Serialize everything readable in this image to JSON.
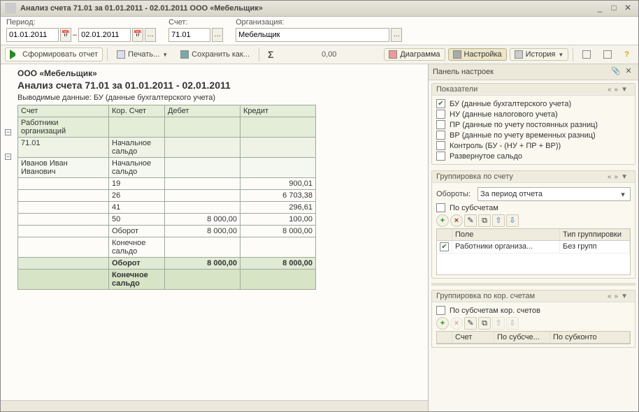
{
  "window": {
    "title": "Анализ счета 71.01 за 01.01.2011 - 02.01.2011 ООО «Мебельщик»"
  },
  "params": {
    "period_label": "Период:",
    "date_from": "01.01.2011",
    "date_to": "02.01.2011",
    "account_label": "Счет:",
    "account": "71.01",
    "org_label": "Организация:",
    "org": "Мебельщик"
  },
  "toolbar": {
    "run": "Сформировать отчет",
    "print": "Печать...",
    "save": "Сохранить как...",
    "sum": "0,00",
    "diagram": "Диаграмма",
    "settings": "Настройка",
    "history": "История"
  },
  "report": {
    "org_line": "ООО «Мебельщик»",
    "title": "Анализ счета 71.01 за 01.01.2011 - 02.01.2011",
    "data_line": "Выводимые данные:  БУ (данные бухгалтерского учета)",
    "headers": {
      "account": "Счет",
      "cor": "Кор. Счет",
      "debit": "Дебет",
      "credit": "Кредит"
    },
    "sub_header": "Работники\nорганизаций",
    "rows": [
      {
        "type": "begin",
        "a": "71.01",
        "b": "Начальное\nсальдо",
        "c": "",
        "d": ""
      },
      {
        "type": "emp",
        "a": "Иванов Иван\nИванович",
        "b": "Начальное\nсальдо",
        "c": "",
        "d": ""
      },
      {
        "type": "data",
        "a": "",
        "b": "19",
        "c": "",
        "d": "900,01"
      },
      {
        "type": "data",
        "a": "",
        "b": "26",
        "c": "",
        "d": "6 703,38"
      },
      {
        "type": "data",
        "a": "",
        "b": "41",
        "c": "",
        "d": "296,61"
      },
      {
        "type": "data",
        "a": "",
        "b": "50",
        "c": "8 000,00",
        "d": "100,00"
      },
      {
        "type": "data",
        "a": "",
        "b": "Оборот",
        "c": "8 000,00",
        "d": "8 000,00"
      },
      {
        "type": "data",
        "a": "",
        "b": "Конечное\nсальдо",
        "c": "",
        "d": ""
      },
      {
        "type": "totob",
        "a": "",
        "b": "Оборот",
        "c": "8 000,00",
        "d": "8 000,00"
      },
      {
        "type": "tot",
        "a": "",
        "b": "Конечное\nсальдо",
        "c": "",
        "d": ""
      }
    ]
  },
  "settings": {
    "panel_title": "Панель настроек",
    "indicators": {
      "title": "Показатели",
      "items": [
        {
          "checked": true,
          "label": "БУ (данные бухгалтерского учета)"
        },
        {
          "checked": false,
          "label": "НУ (данные налогового учета)"
        },
        {
          "checked": false,
          "label": "ПР (данные по учету постоянных разниц)"
        },
        {
          "checked": false,
          "label": "ВР (данные по учету временных разниц)"
        },
        {
          "checked": false,
          "label": "Контроль (БУ - (НУ + ПР + ВР))"
        },
        {
          "checked": false,
          "label": "Развернутое сальдо"
        }
      ]
    },
    "group_acct": {
      "title": "Группировка по счету",
      "turnover_label": "Обороты:",
      "turnover_value": "За период отчета",
      "by_sub": "По субсчетам",
      "grid_hdr_field": "Поле",
      "grid_hdr_type": "Тип группировки",
      "grid_row_field": "Работники организа...",
      "grid_row_type": "Без групп"
    },
    "group_cor": {
      "title": "Группировка по кор. счетам",
      "by_sub": "По субсчетам кор. счетов",
      "grid_hdr_acct": "Счет",
      "grid_hdr_sub": "По субсче...",
      "grid_hdr_subk": "По субконто"
    }
  }
}
